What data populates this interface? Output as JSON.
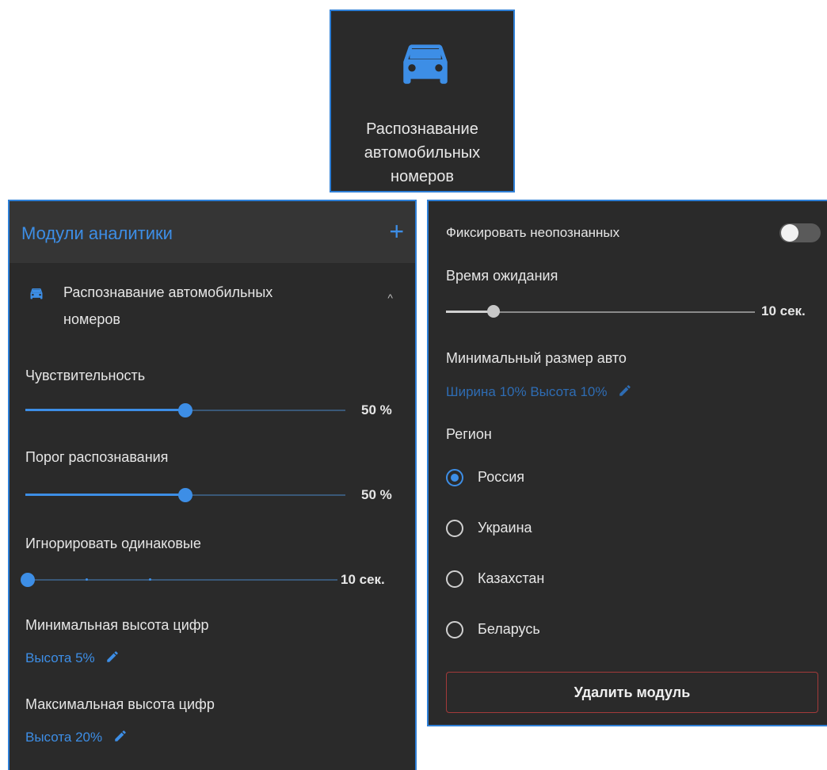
{
  "tile": {
    "label": "Распознавание автомобильных номеров",
    "icon": "car-icon"
  },
  "left": {
    "header": {
      "title": "Модули аналитики",
      "add_symbol": "+"
    },
    "module": {
      "name": "Распознавание автомобильных номеров",
      "icon": "car-icon",
      "chevron": "^"
    },
    "sensitivity": {
      "label": "Чувствительность",
      "value": "50 %",
      "level": 0.5
    },
    "threshold": {
      "label": "Порог распознавания",
      "value": "50 %",
      "level": 0.5
    },
    "ignore": {
      "label": "Игнорировать одинаковые",
      "value": "10 сек."
    },
    "min_height": {
      "label": "Минимальная высота цифр",
      "value": "Высота 5%"
    },
    "max_height": {
      "label": "Максимальная высота цифр",
      "value": "Высота 20%"
    }
  },
  "right": {
    "fix_unrecognized": {
      "label": "Фиксировать неопознанных",
      "enabled": false
    },
    "wait_time": {
      "label": "Время ожидания",
      "value": "10 сек."
    },
    "min_car_size": {
      "label": "Минимальный размер авто",
      "value": "Ширина 10% Высота 10%"
    },
    "region": {
      "label": "Регион",
      "options": [
        "Россия",
        "Украина",
        "Казахстан",
        "Беларусь"
      ],
      "selected": "Россия"
    },
    "delete_label": "Удалить модуль"
  },
  "colors": {
    "accent": "#3d8ee6",
    "panel": "#2a2a2a",
    "danger_border": "#a33a3a"
  }
}
